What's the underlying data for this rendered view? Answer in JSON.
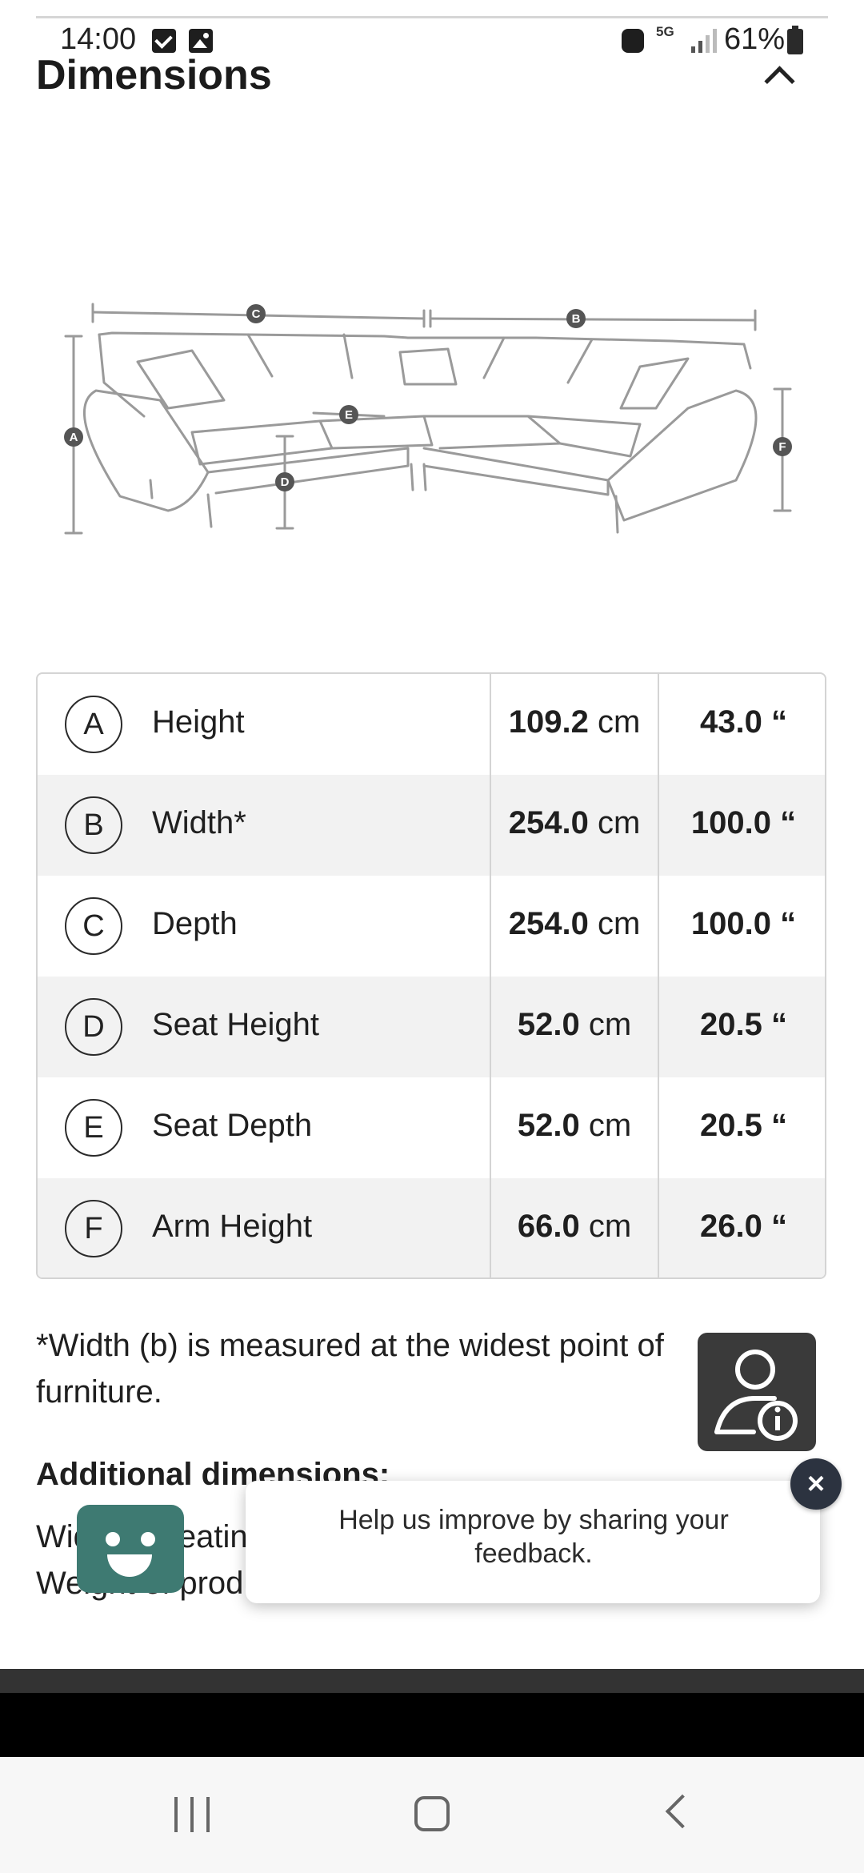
{
  "status_bar": {
    "time": "14:00",
    "network": "5G",
    "battery": "61%"
  },
  "header": {
    "title": "Dimensions"
  },
  "diagram": {
    "markers": [
      "A",
      "B",
      "C",
      "D",
      "E",
      "F"
    ]
  },
  "table": {
    "rows": [
      {
        "letter": "A",
        "name": "Height",
        "cm_value": "109.2",
        "cm_unit": "cm",
        "inches": "43.0 “"
      },
      {
        "letter": "B",
        "name": "Width*",
        "cm_value": "254.0",
        "cm_unit": "cm",
        "inches": "100.0 “"
      },
      {
        "letter": "C",
        "name": "Depth",
        "cm_value": "254.0",
        "cm_unit": "cm",
        "inches": "100.0 “"
      },
      {
        "letter": "D",
        "name": "Seat Height",
        "cm_value": "52.0",
        "cm_unit": "cm",
        "inches": "20.5 “"
      },
      {
        "letter": "E",
        "name": "Seat Depth",
        "cm_value": "52.0",
        "cm_unit": "cm",
        "inches": "20.5 “"
      },
      {
        "letter": "F",
        "name": "Arm Height",
        "cm_value": "66.0",
        "cm_unit": "cm",
        "inches": "26.0 “"
      }
    ]
  },
  "footnote": "*Width (b) is measured at the widest point of furniture.",
  "additional": {
    "title": "Additional dimensions:",
    "line1": "Width of seating",
    "line2": "Weight of product"
  },
  "toast": {
    "message": "Help us improve by sharing your feedback.",
    "close": "×"
  }
}
